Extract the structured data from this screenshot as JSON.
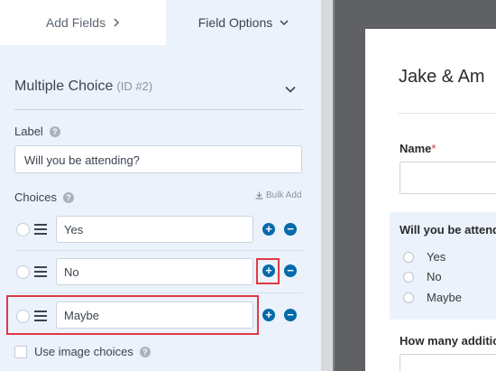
{
  "tabs": {
    "add_fields": "Add Fields",
    "field_options": "Field Options"
  },
  "field": {
    "type": "Multiple Choice",
    "id_text": "(ID #2)"
  },
  "label_section": {
    "title": "Label",
    "value": "Will you be attending?"
  },
  "choices_section": {
    "title": "Choices",
    "bulk_add": "Bulk Add",
    "items": [
      {
        "label": "Yes"
      },
      {
        "label": "No"
      },
      {
        "label": "Maybe"
      }
    ]
  },
  "image_choices": "Use image choices",
  "icons": {
    "help": "?",
    "add": "+",
    "remove": "−"
  },
  "preview": {
    "title": "Jake & Am",
    "name_label": "Name",
    "required_mark": "*",
    "question_label": "Will you be attend",
    "options": [
      "Yes",
      "No",
      "Maybe"
    ],
    "next_label": "How many additio"
  },
  "colors": {
    "accent": "#036aab",
    "highlight": "#e03a43",
    "panel_bg": "#ebf2fb"
  }
}
